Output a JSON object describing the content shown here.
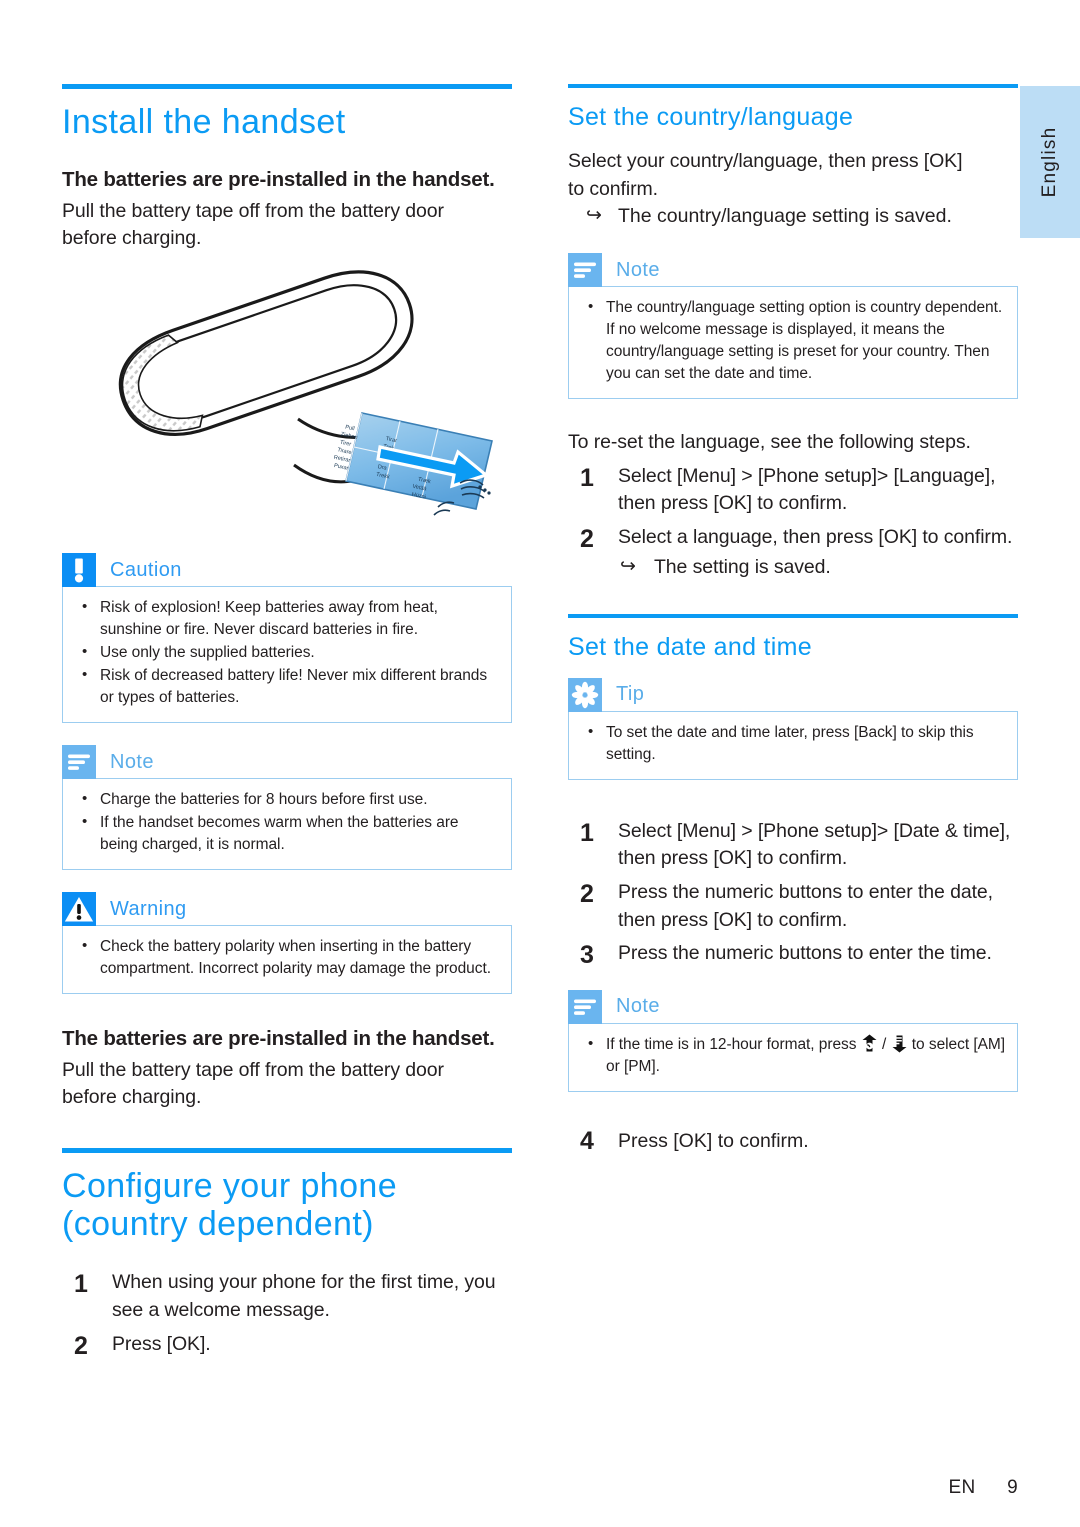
{
  "page": {
    "language_tab": "English",
    "footer": {
      "locale": "EN",
      "page_number": "9"
    },
    "accent_color": "#0b9bf4",
    "callout_badge_light": "#6ab5ef",
    "callout_badge_strong": "#0b8ef4",
    "callout_border": "#9ccdf0",
    "lang_tab_bg": "#bcddf5"
  },
  "left": {
    "chapter_title": "Install the handset",
    "subhead_1": "The batteries are pre-installed in the handset.",
    "body_1_line1": "Pull the battery tape off from the battery door",
    "body_1_line2": "before charging.",
    "illustration": {
      "name": "handset-battery-tape-illustration",
      "tape_labels": [
        "Pull",
        "Ziehen",
        "Tirer",
        "Tirare",
        "Retirar",
        "Puxar",
        "Tirar",
        "Trek",
        "Dra",
        "Trekk",
        "Træk",
        "Vetää",
        "Húzni"
      ]
    },
    "caution": {
      "title": "Caution",
      "items": [
        "Risk of explosion! Keep batteries away from heat, sunshine or fire. Never discard batteries in fire.",
        "Use only the supplied batteries.",
        "Risk of decreased battery life! Never mix different brands or types of batteries."
      ]
    },
    "note": {
      "title": "Note",
      "items": [
        "Charge the batteries for 8 hours before first use.",
        "If the handset becomes warm when the batteries are being charged, it is normal."
      ]
    },
    "warning": {
      "title": "Warning",
      "items": [
        "Check the battery polarity when inserting in the battery compartment. Incorrect polarity may damage the product."
      ]
    },
    "subhead_2": "The batteries are pre-installed in the handset.",
    "body_2_line1": "Pull the battery tape off from the battery door",
    "body_2_line2": "before charging.",
    "chapter_title_2_line1": "Configure your phone",
    "chapter_title_2_line2": "(country dependent)",
    "steps": [
      "When using your phone for the first time, you see a welcome message.",
      "Press [OK]."
    ]
  },
  "right": {
    "section_1_title": "Set the country/language",
    "section_1_body_line1": "Select your country/language, then press [OK]",
    "section_1_body_line2": "to confirm.",
    "section_1_result": "The country/language setting is saved.",
    "note_1": {
      "title": "Note",
      "items": [
        "The country/language setting option is country dependent. If no welcome message is displayed, it means the country/language setting is preset for your country. Then you can set the date and time."
      ]
    },
    "reset_intro": "To re-set the language, see the following steps.",
    "language_steps": [
      "Select [Menu] > [Phone setup]> [Language], then press [OK] to confirm.",
      "Select a language, then press [OK] to confirm."
    ],
    "language_step_2_result": "The setting is saved.",
    "section_2_title": "Set the date and time",
    "tip": {
      "title": "Tip",
      "items": [
        "To set the date and time later, press [Back] to skip this setting."
      ]
    },
    "datetime_steps": [
      "Select [Menu] > [Phone setup]> [Date & time], then press [OK] to confirm.",
      "Press the numeric buttons to enter the date, then press [OK] to confirm.",
      "Press the numeric buttons to enter the time."
    ],
    "note_2": {
      "title": "Note",
      "item_prefix": "If the time is in 12-hour format, press",
      "item_separator": "/",
      "item_suffix": "to select [AM] or [PM].",
      "icon_up": "phone-up-key-icon",
      "icon_down": "menu-down-key-icon"
    },
    "final_step_number": "4",
    "final_step_text": "Press [OK] to confirm."
  }
}
